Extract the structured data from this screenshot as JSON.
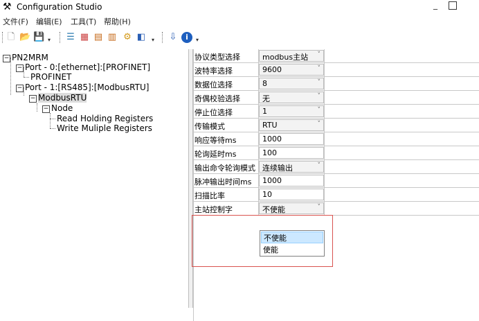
{
  "window": {
    "title": "Configuration Studio"
  },
  "menu": {
    "items": [
      "文件(F)",
      "编辑(E)",
      "工具(T)",
      "帮助(H)"
    ]
  },
  "toolbar": {
    "buttons": [
      "new-icon",
      "open-icon",
      "save-icon",
      "align-icon",
      "grid-icon",
      "add-icon",
      "module-icon",
      "settings-icon",
      "export-icon",
      "download-icon",
      "info-icon"
    ]
  },
  "tree": {
    "root": "PN2MRM",
    "port0": "Port - 0:[ethernet]:[PROFINET]",
    "profinet": "PROFINET",
    "port1": "Port - 1:[RS485]:[ModbusRTU]",
    "modbusrtu": "ModbusRTU",
    "node": "Node",
    "read": "Read Holding Registers",
    "write": "Write Muliple Registers"
  },
  "properties": [
    {
      "label": "协议类型选择",
      "value": "modbus主站",
      "combo": true
    },
    {
      "label": "波特率选择",
      "value": "9600",
      "combo": true
    },
    {
      "label": "数据位选择",
      "value": "8",
      "combo": true
    },
    {
      "label": "奇偶校验选择",
      "value": "无",
      "combo": true
    },
    {
      "label": "停止位选择",
      "value": "1",
      "combo": true
    },
    {
      "label": "传输模式",
      "value": "RTU",
      "combo": true
    },
    {
      "label": "响应等待ms",
      "value": "1000",
      "combo": false
    },
    {
      "label": "轮询延时ms",
      "value": "100",
      "combo": false
    },
    {
      "label": "输出命令轮询模式",
      "value": "连续输出",
      "combo": true
    },
    {
      "label": "脉冲输出时间ms",
      "value": "1000",
      "combo": false
    },
    {
      "label": "扫描比率",
      "value": "10",
      "combo": false
    },
    {
      "label": "主站控制字",
      "value": "不使能",
      "combo": true
    }
  ],
  "dropdown": {
    "options": [
      "不使能",
      "使能"
    ],
    "selected": "不使能"
  },
  "colors": {
    "highlight": "#d9534f",
    "selection": "#cce8ff"
  }
}
